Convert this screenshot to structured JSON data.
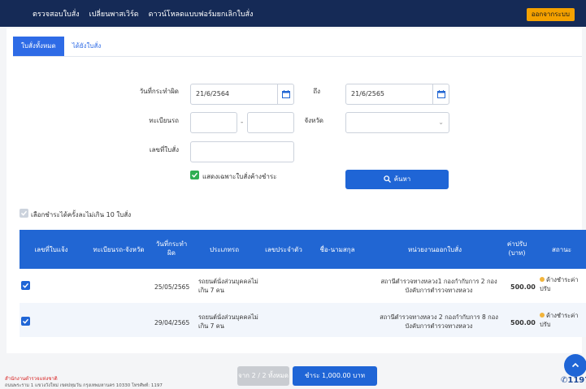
{
  "topnav": {
    "items": [
      "ตรวจสอบใบสั่ง",
      "เปลี่ยนพาสเวิร์ด",
      "ดาวน์โหลดแบบฟอร์มยกเลิกใบสั่ง"
    ],
    "logout": "ออกจากระบบ"
  },
  "tabs": [
    "ใบสั่งทั้งหมด",
    "ได้ยังใบสั่ง"
  ],
  "filters": {
    "date_from_label": "วันที่กระทำผิด",
    "date_from": "21/6/2564",
    "date_to_label": "ถึง",
    "date_to": "21/6/2565",
    "plate_label": "ทะเบียนรถ",
    "plate_sep": "-",
    "province_label": "จังหวัด",
    "ticket_label": "เลขที่ใบสั่ง",
    "only_unpaid": "แสดงเฉพาะใบสั่งค้างชำระ",
    "search": "ค้นหา"
  },
  "bulk_note": "เลือกชำระได้ครั้งละไม่เกิน 10 ใบสั่ง",
  "table": {
    "headers": [
      "เลขที่ใบแจ้ง",
      "ทะเบียนรถ-จังหวัด",
      "วันที่กระทำผิด",
      "ประเภทรถ",
      "เลขประจำตัว",
      "ชื่อ-นามสกุล",
      "หน่วยงานออกใบสั่ง",
      "ค่าปรับ (บาท)",
      "สถานะ"
    ],
    "rows": [
      {
        "date": "25/05/2565",
        "type": "รถยนต์นั่งส่วนบุคคลไม่เกิน 7 คน",
        "agency": "สถานีตำรวจทางหลวง1 กองกำกับการ 2 กองบังคับการตำรวจทางหลวง",
        "fee": "500.00",
        "status": "ค้างชำระค่าปรับ"
      },
      {
        "date": "29/04/2565",
        "type": "รถยนต์นั่งส่วนบุคคลไม่เกิน 7 คน",
        "agency": "สถานีตำรวจทางหลวง 2 กองกำกับการ 8 กองบังคับการตำรวจทางหลวง",
        "fee": "500.00",
        "status": "ค้างชำระค่าปรับ"
      }
    ]
  },
  "footer": {
    "org": "สำนักงานตำรวจแห่งชาติ",
    "address": "ถนนพระราม 1 แขวงวังใหม่ เขตปทุมวัน กรุงเทพมหานคร 10330 โทรศัพท์: 1197",
    "page_label": "จาก 2 / 2 ทั้งหมด",
    "pay_label": "ชำระ 1,000.00 บาท",
    "hotline": "1197"
  },
  "colors": {
    "nav": "#152a56",
    "primary": "#2166d3",
    "accent": "#f4a100",
    "check": "#2eae52"
  }
}
